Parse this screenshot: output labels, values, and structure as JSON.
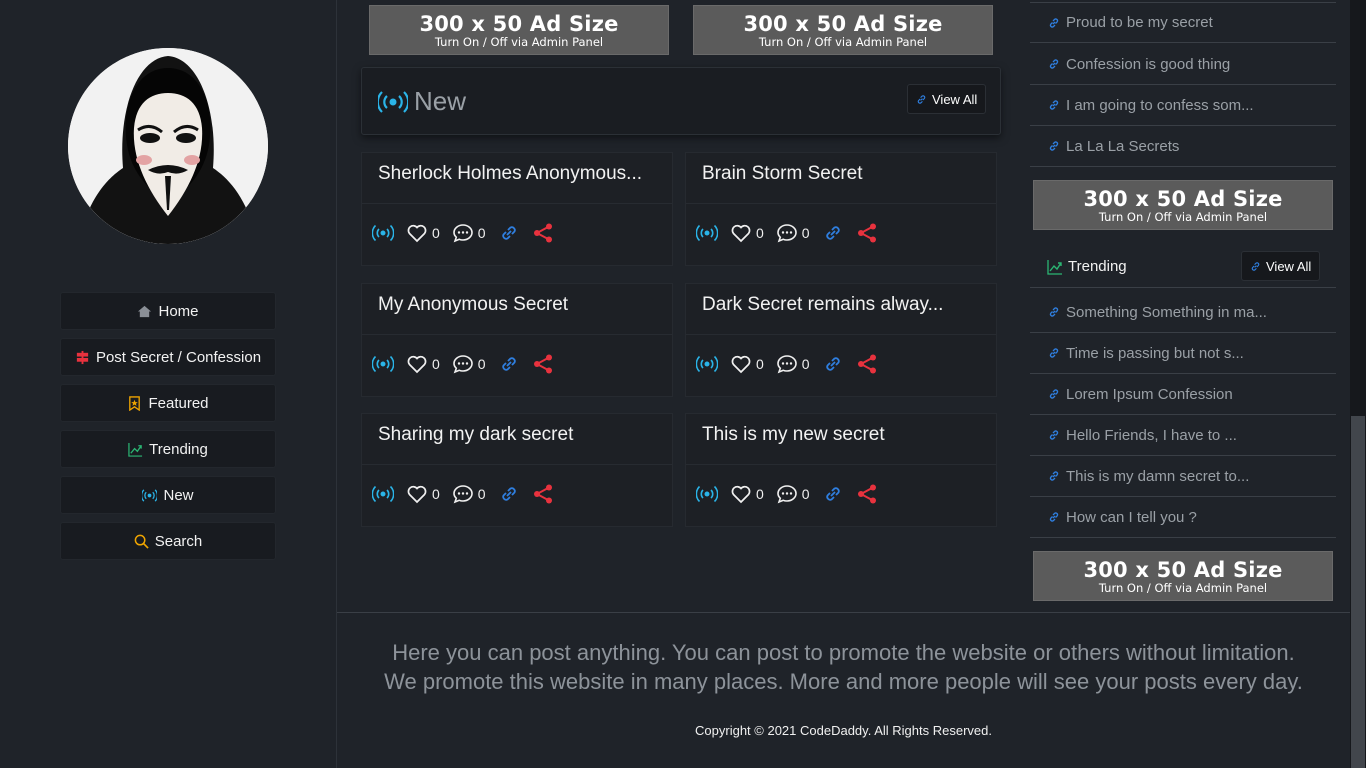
{
  "sidebar": {
    "nav": [
      {
        "label": "Home",
        "icon": "home-icon"
      },
      {
        "label": "Post Secret / Confession",
        "icon": "signpost-icon"
      },
      {
        "label": "Featured",
        "icon": "bookmark-star-icon"
      },
      {
        "label": "Trending",
        "icon": "trending-icon"
      },
      {
        "label": "New",
        "icon": "broadcast-icon"
      },
      {
        "label": "Search",
        "icon": "search-icon"
      }
    ]
  },
  "ads": {
    "big": "300 x 50 Ad Size",
    "small": "Turn On / Off via Admin Panel"
  },
  "new_section": {
    "title": "New",
    "view_all": "View All"
  },
  "cards": [
    {
      "title": "Sherlock Holmes Anonymous...",
      "likes": "0",
      "comments": "0"
    },
    {
      "title": "Brain Storm Secret",
      "likes": "0",
      "comments": "0"
    },
    {
      "title": "My Anonymous Secret",
      "likes": "0",
      "comments": "0"
    },
    {
      "title": "Dark Secret remains alway...",
      "likes": "0",
      "comments": "0"
    },
    {
      "title": "Sharing my dark secret",
      "likes": "0",
      "comments": "0"
    },
    {
      "title": "This is my new secret",
      "likes": "0",
      "comments": "0"
    }
  ],
  "right": {
    "top_links": [
      "Proud to be my secret",
      "Confession is good thing",
      "I am going to confess som...",
      "La La La Secrets"
    ],
    "trending_title": "Trending",
    "trending_view_all": "View All",
    "trending_links": [
      "Something Something in ma...",
      "Time is passing but not s...",
      "Lorem Ipsum Confession",
      "Hello Friends, I have to ...",
      "This is my damn secret to...",
      "How can I tell you ?"
    ]
  },
  "footer": {
    "line1": "Here you can post anything. You can post to promote the website or others without limitation.",
    "line2": "We promote this website in many places. More and more people will see your posts every day.",
    "copyright": "Copyright © 2021  CodeDaddy. All Rights Reserved."
  },
  "colors": {
    "background": "#1f2329",
    "broadcast": "#2ab4e8",
    "link": "#2f7fe0",
    "share": "#e8323e",
    "post_secret": "#e8323e",
    "featured": "#f0a500",
    "trending": "#2bb673"
  }
}
